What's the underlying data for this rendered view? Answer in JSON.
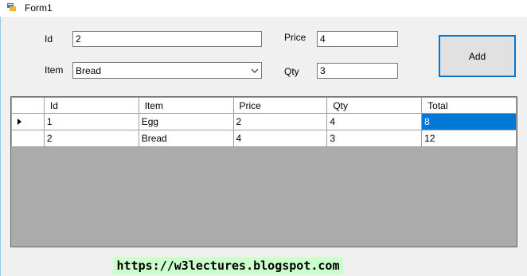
{
  "window": {
    "title": "Form1"
  },
  "form": {
    "id_label": "Id",
    "id_value": "2",
    "item_label": "Item",
    "item_value": "Bread",
    "price_label": "Price",
    "price_value": "4",
    "qty_label": "Qty",
    "qty_value": "3",
    "add_label": "Add"
  },
  "grid": {
    "columns": [
      "Id",
      "Item",
      "Price",
      "Qty",
      "Total"
    ],
    "rows": [
      {
        "id": "1",
        "item": "Egg",
        "price": "2",
        "qty": "4",
        "total": "8"
      },
      {
        "id": "2",
        "item": "Bread",
        "price": "4",
        "qty": "3",
        "total": "12"
      }
    ]
  },
  "watermark": {
    "text": "https://w3lectures.blogspot.com"
  }
}
